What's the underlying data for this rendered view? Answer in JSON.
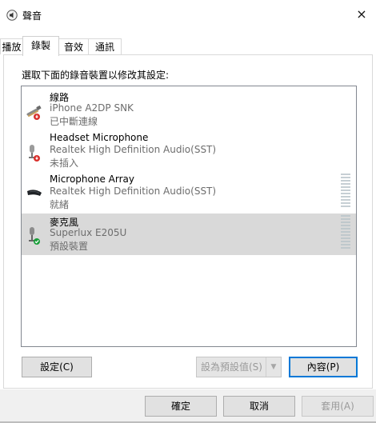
{
  "window": {
    "title": "聲音",
    "close_symbol": "×",
    "icon": "speaker-icon"
  },
  "tabs": [
    {
      "label": "播放",
      "active": false
    },
    {
      "label": "錄製",
      "active": true
    },
    {
      "label": "音效",
      "active": false
    },
    {
      "label": "通訊",
      "active": false
    }
  ],
  "prompt": "選取下面的錄音裝置以修改其設定:",
  "devices": [
    {
      "name": "線路",
      "driver": "iPhone A2DP SNK",
      "status": "已中斷連線",
      "icon": "line-in-cable-icon",
      "badge": "disconnected-badge-icon",
      "selected": false,
      "meter": false
    },
    {
      "name": "Headset Microphone",
      "driver": "Realtek High Definition Audio(SST)",
      "status": "未插入",
      "icon": "headset-microphone-icon",
      "badge": "unplugged-badge-icon",
      "selected": false,
      "meter": false
    },
    {
      "name": "Microphone Array",
      "driver": "Realtek High Definition Audio(SST)",
      "status": "就緒",
      "icon": "microphone-array-icon",
      "badge": "",
      "selected": false,
      "meter": true
    },
    {
      "name": "麥克風",
      "driver": "Superlux E205U",
      "status": "預設裝置",
      "icon": "microphone-icon",
      "badge": "default-check-badge-icon",
      "selected": true,
      "meter": true
    }
  ],
  "buttons": {
    "configure": "設定(C)",
    "set_default": "設為預設值(S)",
    "set_default_arrow": "▼",
    "properties": "內容(P)",
    "ok": "確定",
    "cancel": "取消",
    "apply": "套用(A)"
  },
  "colors": {
    "selected_row": "#d9d9d9",
    "accent_focus": "#0078d7",
    "error_badge": "#d9302c",
    "ok_badge": "#1a9e3a",
    "meter": "#c6cfd4"
  }
}
